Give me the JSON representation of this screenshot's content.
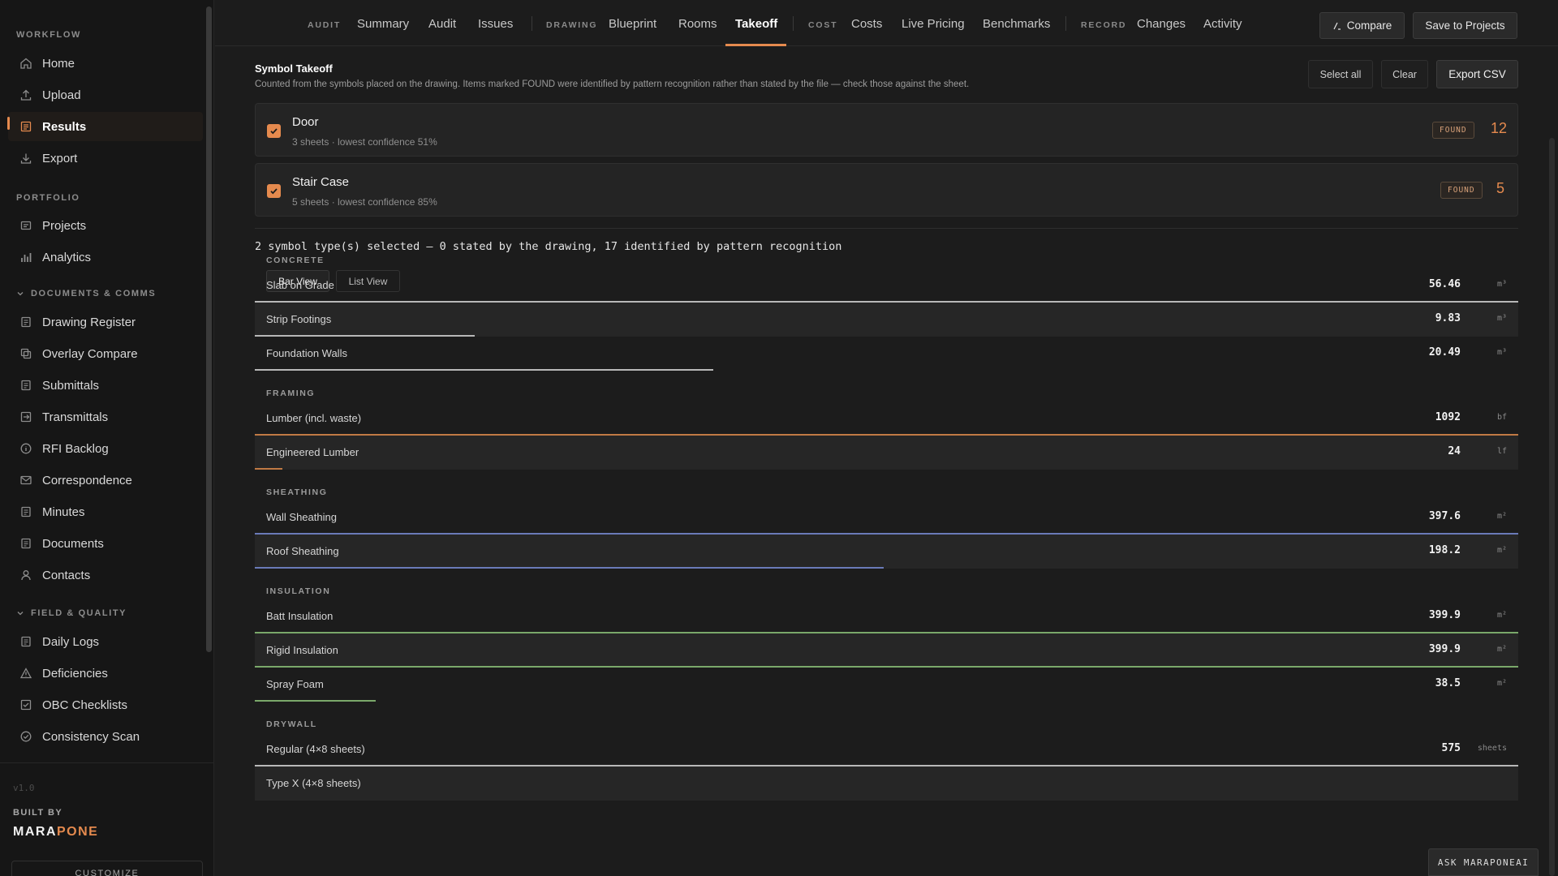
{
  "sidebar": {
    "sections": [
      {
        "label": "WORKFLOW"
      },
      {
        "label": "PORTFOLIO"
      },
      {
        "label": "DOCUMENTS & COMMS"
      },
      {
        "label": "FIELD & QUALITY"
      }
    ],
    "items": [
      {
        "label": "Home",
        "icon": "home-icon"
      },
      {
        "label": "Upload",
        "icon": "upload-icon"
      },
      {
        "label": "Results",
        "icon": "results-icon",
        "active": true
      },
      {
        "label": "Export",
        "icon": "export-icon"
      },
      {
        "label": "Projects",
        "icon": "projects-icon"
      },
      {
        "label": "Analytics",
        "icon": "analytics-icon"
      },
      {
        "label": "Drawing Register",
        "icon": "document-icon"
      },
      {
        "label": "Overlay Compare",
        "icon": "overlay-icon"
      },
      {
        "label": "Submittals",
        "icon": "document-icon"
      },
      {
        "label": "Transmittals",
        "icon": "transmittal-icon"
      },
      {
        "label": "RFI Backlog",
        "icon": "info-icon"
      },
      {
        "label": "Correspondence",
        "icon": "mail-icon"
      },
      {
        "label": "Minutes",
        "icon": "document-icon"
      },
      {
        "label": "Documents",
        "icon": "document-icon"
      },
      {
        "label": "Contacts",
        "icon": "person-icon"
      },
      {
        "label": "Daily Logs",
        "icon": "document-icon"
      },
      {
        "label": "Deficiencies",
        "icon": "warning-icon"
      },
      {
        "label": "OBC Checklists",
        "icon": "checklist-icon"
      },
      {
        "label": "Consistency Scan",
        "icon": "check-circle-icon"
      }
    ],
    "version": "v1.0",
    "built_by": "BUILT BY",
    "brand_part1": "MARA",
    "brand_part2": "PONE",
    "customize": "CUSTOMIZE"
  },
  "topnav": {
    "groups": [
      {
        "label": "AUDIT",
        "tabs": [
          "Summary",
          "Audit",
          "Issues"
        ]
      },
      {
        "label": "DRAWING",
        "tabs": [
          "Blueprint",
          "Rooms",
          "Takeoff"
        ]
      },
      {
        "label": "COST",
        "tabs": [
          "Costs",
          "Live Pricing",
          "Benchmarks"
        ]
      },
      {
        "label": "RECORD",
        "tabs": [
          "Changes",
          "Activity"
        ]
      }
    ],
    "active_tab": "Takeoff",
    "compare_label": "Compare",
    "save_label": "Save to Projects"
  },
  "takeoff": {
    "title": "Symbol Takeoff",
    "description": "Counted from the symbols placed on the drawing. Items marked FOUND were identified by pattern recognition rather than stated by the file — check those against the sheet.",
    "select_all": "Select all",
    "clear": "Clear",
    "export_csv": "Export CSV",
    "symbols": [
      {
        "name": "Door",
        "meta": "3 sheets · lowest confidence 51%",
        "badge": "FOUND",
        "count": "12",
        "checked": true
      },
      {
        "name": "Stair Case",
        "meta": "5 sheets · lowest confidence 85%",
        "badge": "FOUND",
        "count": "5",
        "checked": true
      }
    ],
    "summary": "2 symbol type(s) selected — 0 stated by the drawing, 17 identified by pattern recognition",
    "views": {
      "bar": "Bar View",
      "list": "List View",
      "active": "bar"
    }
  },
  "quantities": {
    "categories": [
      {
        "label": "CONCRETE",
        "color": "#b8b8b8",
        "rows": [
          {
            "name": "Slab on Grade",
            "value": "56.46",
            "unit": "m³",
            "fraction": 1.0
          },
          {
            "name": "Strip Footings",
            "value": "9.83",
            "unit": "m³",
            "fraction": 0.174
          },
          {
            "name": "Foundation Walls",
            "value": "20.49",
            "unit": "m³",
            "fraction": 0.363
          }
        ]
      },
      {
        "label": "FRAMING",
        "color": "#c07a44",
        "rows": [
          {
            "name": "Lumber (incl. waste)",
            "value": "1092",
            "unit": "bf",
            "fraction": 1.0
          },
          {
            "name": "Engineered Lumber",
            "value": "24",
            "unit": "lf",
            "fraction": 0.022
          }
        ]
      },
      {
        "label": "SHEATHING",
        "color": "#6a7ab8",
        "rows": [
          {
            "name": "Wall Sheathing",
            "value": "397.6",
            "unit": "m²",
            "fraction": 1.0
          },
          {
            "name": "Roof Sheathing",
            "value": "198.2",
            "unit": "m²",
            "fraction": 0.498
          }
        ]
      },
      {
        "label": "INSULATION",
        "color": "#7aa86a",
        "rows": [
          {
            "name": "Batt Insulation",
            "value": "399.9",
            "unit": "m²",
            "fraction": 1.0
          },
          {
            "name": "Rigid Insulation",
            "value": "399.9",
            "unit": "m²",
            "fraction": 1.0
          },
          {
            "name": "Spray Foam",
            "value": "38.5",
            "unit": "m²",
            "fraction": 0.096
          }
        ]
      },
      {
        "label": "DRYWALL",
        "color": "#b8b8b8",
        "rows": [
          {
            "name": "Regular (4×8 sheets)",
            "value": "575",
            "unit": "sheets",
            "fraction": 1.0
          },
          {
            "name": "Type X (4×8 sheets)",
            "value": "",
            "unit": "",
            "fraction": 0
          }
        ]
      }
    ]
  },
  "assistant": {
    "label": "ASK MARAPONEAI"
  },
  "colors": {
    "accent": "#e58a4e",
    "background": "#1c1c1c",
    "sidebar": "#161616"
  }
}
